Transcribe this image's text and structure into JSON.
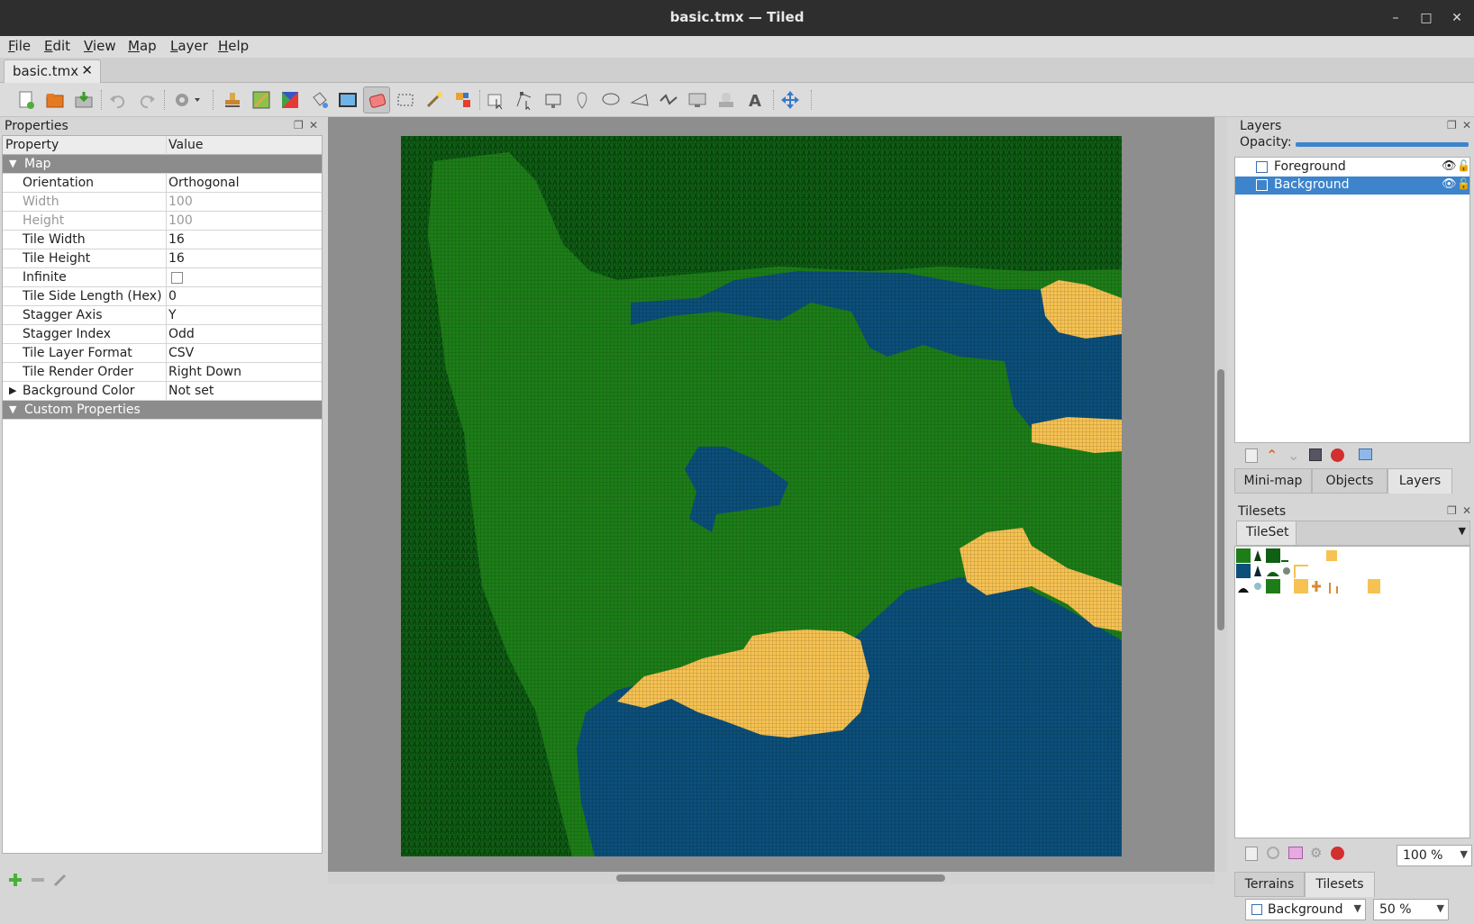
{
  "window": {
    "title": "basic.tmx — Tiled",
    "minimize": "–",
    "maximize": "□",
    "close": "✕"
  },
  "menu": [
    "File",
    "Edit",
    "View",
    "Map",
    "Layer",
    "Help"
  ],
  "tab": {
    "label": "basic.tmx",
    "close": "✕"
  },
  "toolbar": {
    "tools": [
      "new-file",
      "open-file",
      "save-file",
      "undo",
      "redo",
      "commands",
      "stamp-brush",
      "terrain-brush",
      "wang-brush",
      "bucket-fill",
      "shape-fill",
      "eraser",
      "rectangular-select",
      "magic-wand",
      "select-same-tile",
      "select-objects",
      "edit-polygons",
      "insert-rectangle",
      "insert-point",
      "insert-ellipse",
      "insert-polygon",
      "insert-polyline",
      "insert-tile",
      "insert-template",
      "insert-text",
      "layer-offset"
    ],
    "active": "eraser"
  },
  "properties": {
    "title": "Properties",
    "header": {
      "property": "Property",
      "value": "Value"
    },
    "group_map": "Map",
    "rows": [
      {
        "key": "Orientation",
        "value": "Orthogonal",
        "readonly": false
      },
      {
        "key": "Width",
        "value": "100",
        "readonly": true
      },
      {
        "key": "Height",
        "value": "100",
        "readonly": true
      },
      {
        "key": "Tile Width",
        "value": "16",
        "readonly": false
      },
      {
        "key": "Tile Height",
        "value": "16",
        "readonly": false
      },
      {
        "key": "Infinite",
        "value": "",
        "readonly": false
      },
      {
        "key": "Tile Side Length (Hex)",
        "value": "0",
        "readonly": false
      },
      {
        "key": "Stagger Axis",
        "value": "Y",
        "readonly": false
      },
      {
        "key": "Stagger Index",
        "value": "Odd",
        "readonly": false
      },
      {
        "key": "Tile Layer Format",
        "value": "CSV",
        "readonly": false
      },
      {
        "key": "Tile Render Order",
        "value": "Right Down",
        "readonly": false
      },
      {
        "key": "Background Color",
        "value": "Not set",
        "readonly": false
      }
    ],
    "group_custom": "Custom Properties"
  },
  "layers": {
    "title": "Layers",
    "opacity_label": "Opacity:",
    "opacity": 1.0,
    "items": [
      {
        "name": "Foreground",
        "selected": false
      },
      {
        "name": "Background",
        "selected": true
      }
    ],
    "tabs": [
      "Mini-map",
      "Objects",
      "Layers"
    ],
    "active_tab": "Layers"
  },
  "tilesets": {
    "title": "Tilesets",
    "tab": "TileSet",
    "zoom": "100 %",
    "tabs": [
      "Terrains",
      "Tilesets"
    ],
    "active_tab": "Tilesets"
  },
  "status": {
    "layer": "Background",
    "zoom": "50 %"
  },
  "colors": {
    "forest": "#0f5f14",
    "grass": "#1d7d18",
    "water": "#0c4f7a",
    "sand": "#f6c252",
    "selection": "#3d84cc"
  }
}
